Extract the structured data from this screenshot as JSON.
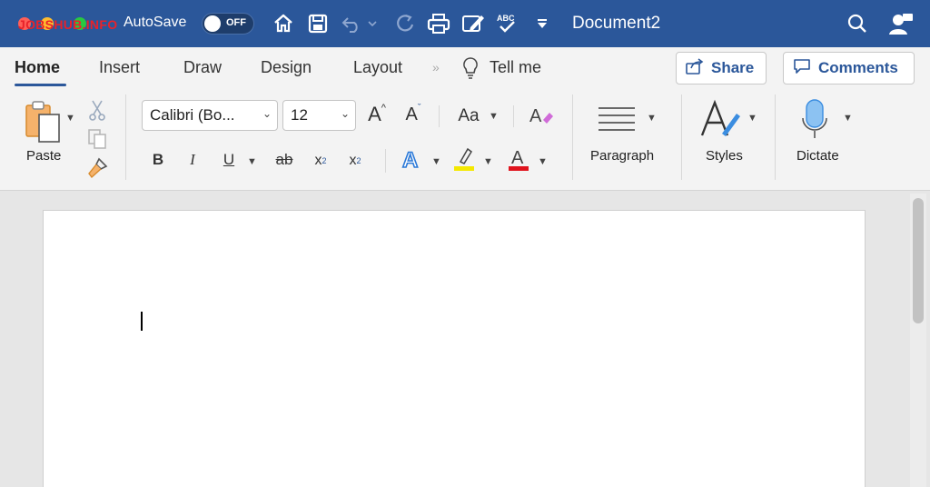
{
  "titlebar": {
    "watermark": "JOBSHUB.INFO",
    "autosave_label": "AutoSave",
    "autosave_state": "OFF",
    "document_title": "Document2",
    "icons": [
      "home-icon",
      "save-icon",
      "undo-icon",
      "redo-icon",
      "print-icon",
      "edit-icon",
      "spelling-icon",
      "customize-toolbar-icon",
      "search-icon",
      "share-user-icon"
    ],
    "bg_color": "#2b579a"
  },
  "tabs": [
    {
      "label": "Home",
      "active": true
    },
    {
      "label": "Insert"
    },
    {
      "label": "Draw"
    },
    {
      "label": "Design"
    },
    {
      "label": "Layout"
    }
  ],
  "tell_me": "Tell me",
  "share_label": "Share",
  "comments_label": "Comments",
  "ribbon": {
    "paste_label": "Paste",
    "font_name": "Calibri (Bo...",
    "font_size": "12",
    "change_case": "Aa",
    "paragraph_label": "Paragraph",
    "styles_label": "Styles",
    "dictate_label": "Dictate",
    "highlight_color": "#f4e800",
    "font_color": "#e0141e"
  },
  "document": {
    "cursor": "|"
  }
}
